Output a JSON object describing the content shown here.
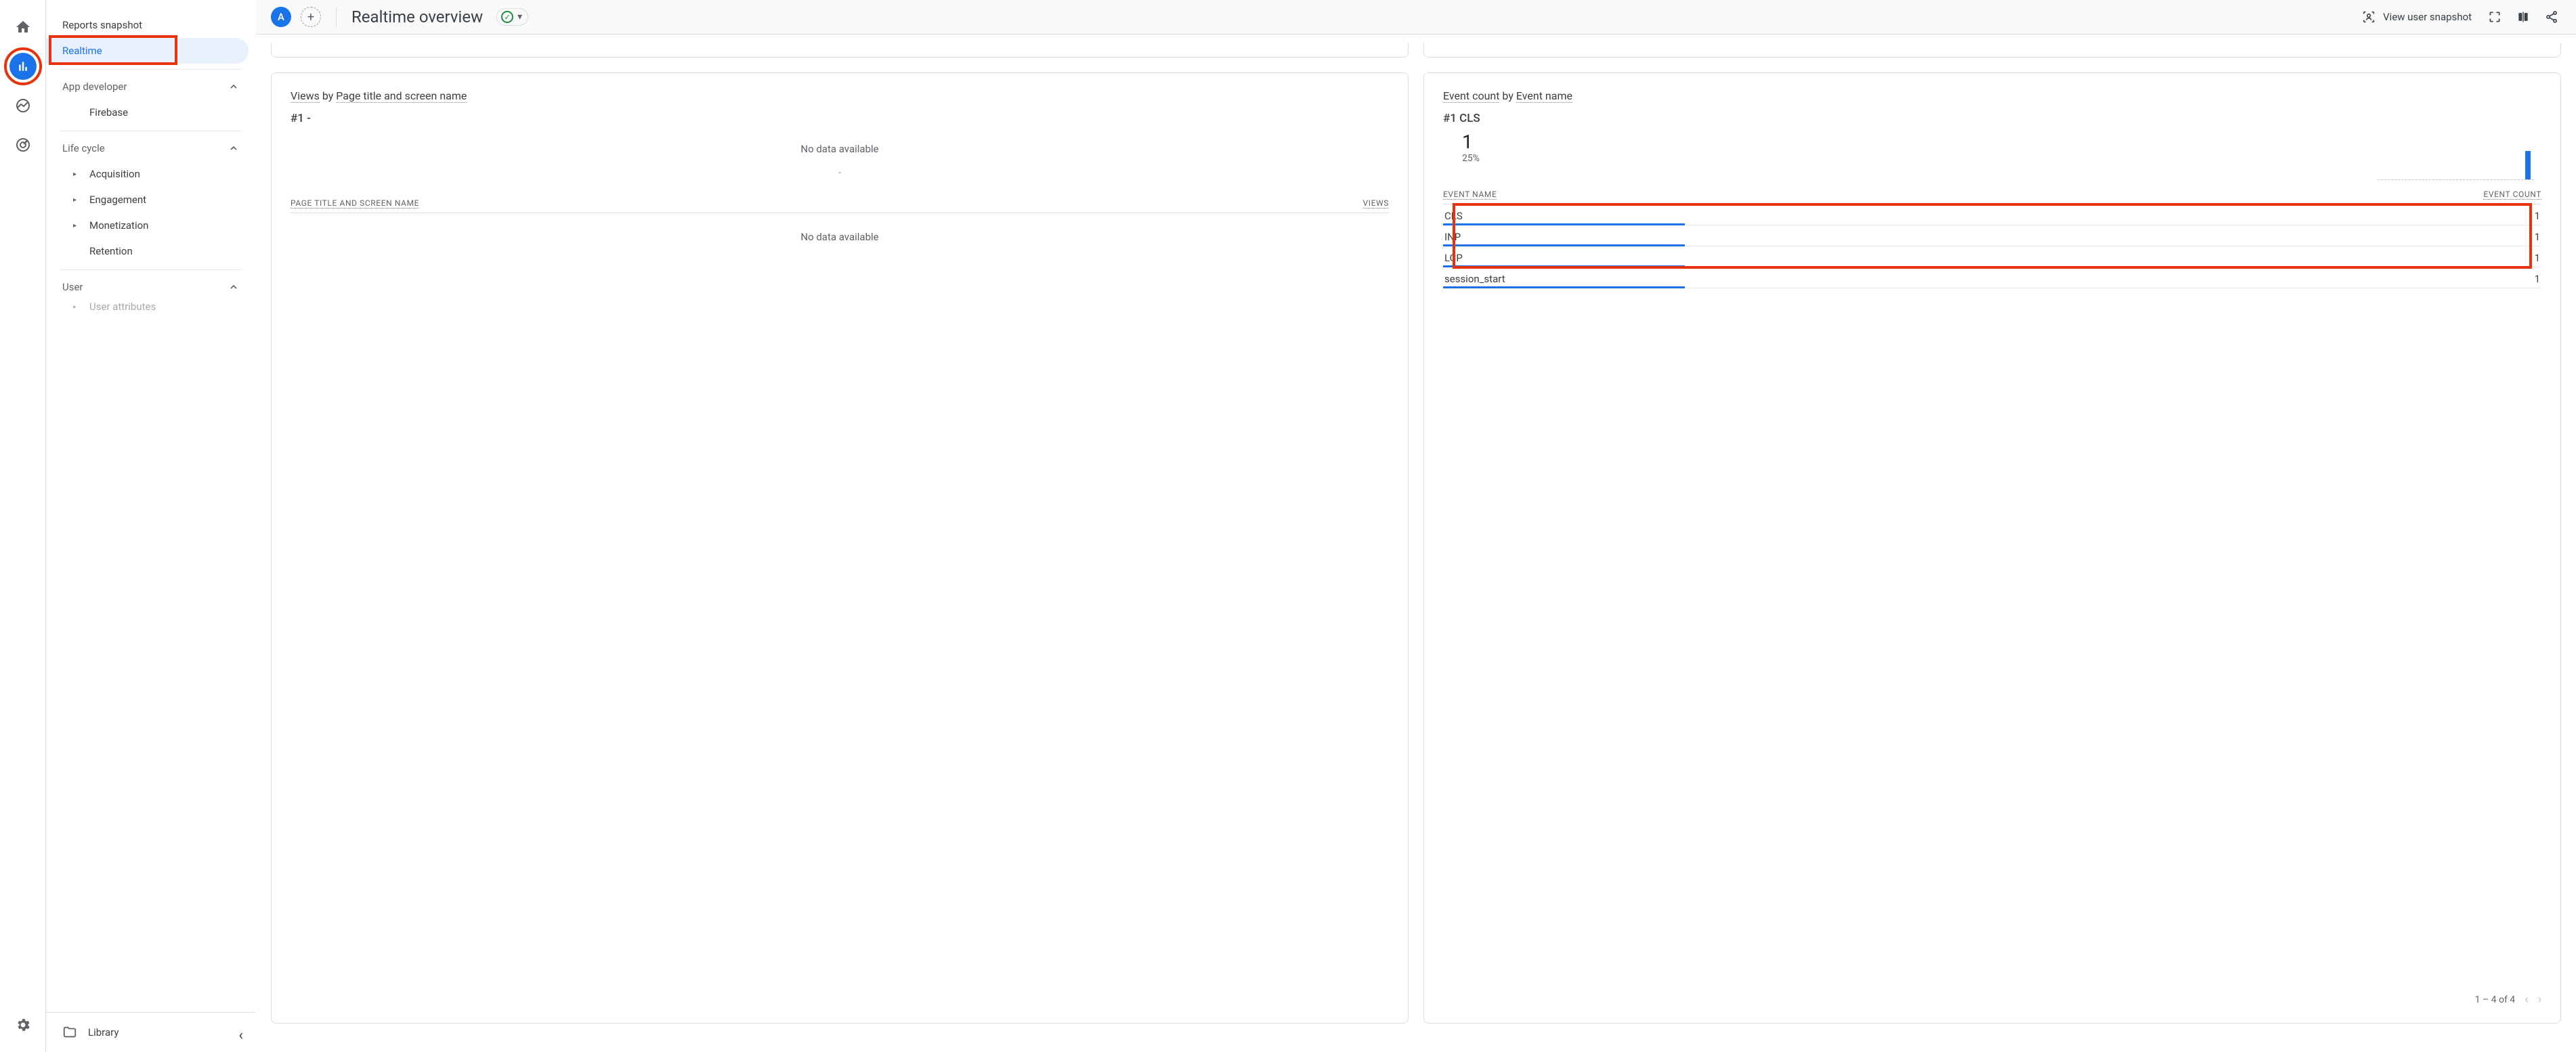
{
  "rail": {
    "home": "home-icon",
    "reports": "bar-chart-icon",
    "explore": "explore-icon",
    "advertising": "target-icon",
    "admin": "gear-icon"
  },
  "sidebar": {
    "reports_snapshot": "Reports snapshot",
    "realtime": "Realtime",
    "sections": {
      "app_developer": {
        "label": "App developer",
        "items": [
          "Firebase"
        ]
      },
      "life_cycle": {
        "label": "Life cycle",
        "items": [
          "Acquisition",
          "Engagement",
          "Monetization",
          "Retention"
        ]
      },
      "user": {
        "label": "User",
        "items": [
          "User attributes"
        ]
      }
    },
    "library": "Library"
  },
  "header": {
    "avatar_letter": "A",
    "title": "Realtime overview",
    "view_user_snapshot": "View user snapshot"
  },
  "cards": {
    "views": {
      "title_a": "Views",
      "title_by": " by ",
      "title_b": "Page title and screen name",
      "rank": "#1  -",
      "no_data_top": "No data available",
      "col_a": "PAGE TITLE AND SCREEN NAME",
      "col_b": "VIEWS",
      "dash": "-",
      "no_data_body": "No data available"
    },
    "events": {
      "title_a": "Event count",
      "title_by": " by ",
      "title_b": "Event name",
      "rank": "#1  CLS",
      "big_value": "1",
      "pct": "25%",
      "col_a": "EVENT NAME",
      "col_b": "EVENT COUNT",
      "rows": [
        {
          "name": "CLS",
          "count": "1",
          "bar": 22
        },
        {
          "name": "INP",
          "count": "1",
          "bar": 22
        },
        {
          "name": "LCP",
          "count": "1",
          "bar": 22
        },
        {
          "name": "session_start",
          "count": "1",
          "bar": 22
        }
      ],
      "pager": "1 – 4 of 4"
    }
  },
  "chart_data": {
    "type": "bar",
    "title": "Event count by Event name",
    "categories": [
      "CLS",
      "INP",
      "LCP",
      "session_start"
    ],
    "values": [
      1,
      1,
      1,
      1
    ],
    "xlabel": "Event name",
    "ylabel": "Event count",
    "ylim": [
      0,
      1
    ],
    "top_event": {
      "name": "CLS",
      "count": 1,
      "share_pct": 25
    }
  }
}
